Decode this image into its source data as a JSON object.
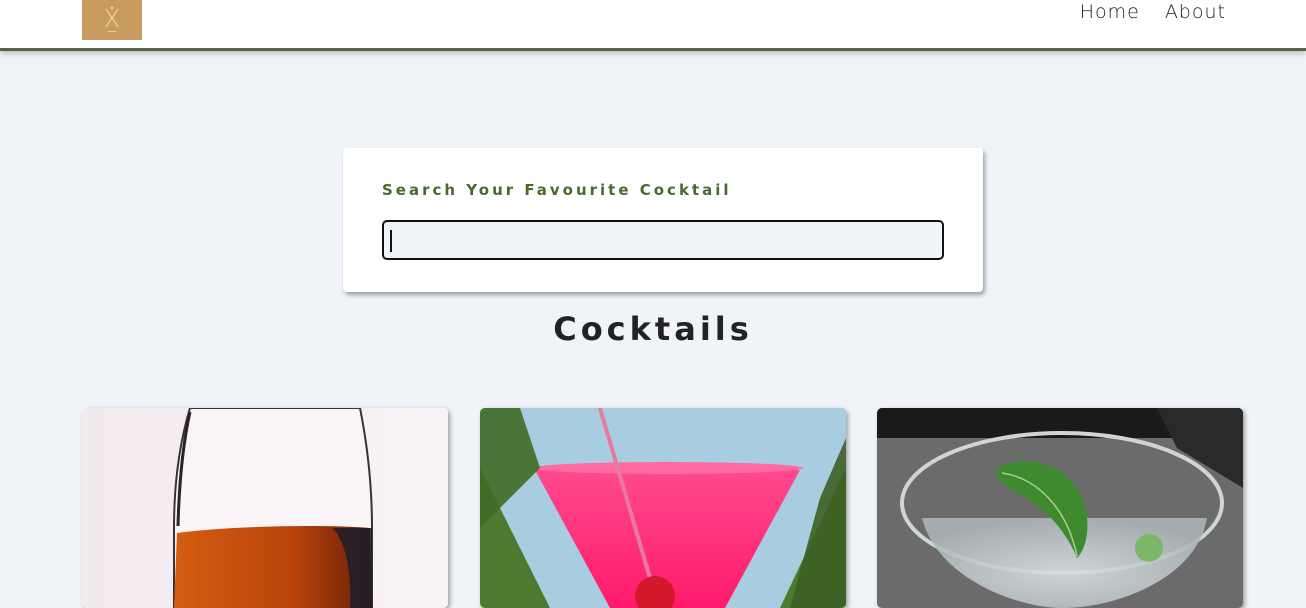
{
  "header": {
    "logo_icon": "cocktail-logo-icon",
    "nav": [
      {
        "label": "Home"
      },
      {
        "label": "About"
      }
    ]
  },
  "search": {
    "label": "Search Your Favourite Cocktail",
    "value": "",
    "placeholder": ""
  },
  "main": {
    "title": "Cocktails",
    "cards": [
      {
        "image": "amber-wine-glass-photo"
      },
      {
        "image": "pink-martini-photo"
      },
      {
        "image": "clear-cocktail-with-mint-photo"
      }
    ]
  },
  "colors": {
    "page_background": "#f0f4f8",
    "accent_green": "#476a2e",
    "logo_background": "#c89a5e",
    "navbar_border": "#5a6248"
  }
}
